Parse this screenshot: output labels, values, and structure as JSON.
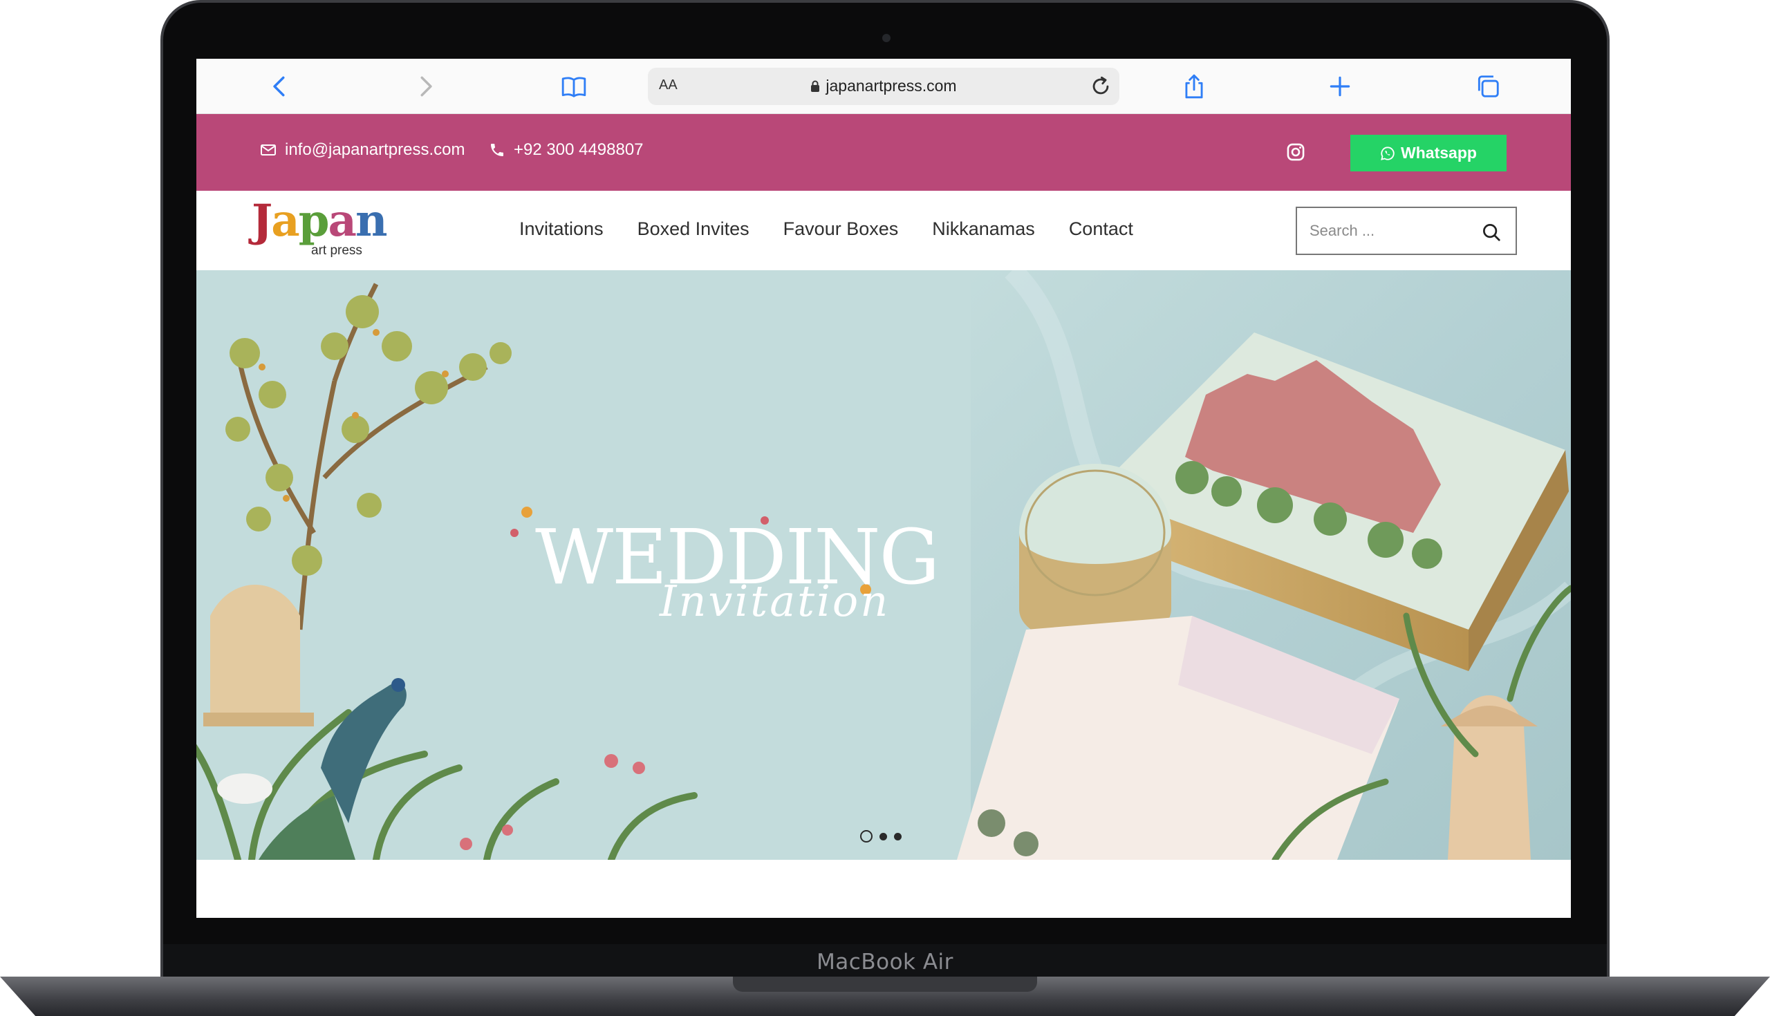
{
  "device": {
    "label": "MacBook Air"
  },
  "browser": {
    "reader_label": "AA",
    "url": "japanartpress.com"
  },
  "topbar": {
    "email": "info@japanartpress.com",
    "phone": "+92 300 4498807",
    "whatsapp_label": "Whatsapp"
  },
  "logo": {
    "name": "Japan",
    "tagline": "art press"
  },
  "nav": {
    "items": [
      {
        "label": "Invitations"
      },
      {
        "label": "Boxed Invites"
      },
      {
        "label": "Favour Boxes"
      },
      {
        "label": "Nikkanamas"
      },
      {
        "label": "Contact"
      }
    ]
  },
  "search": {
    "placeholder": "Search ..."
  },
  "hero": {
    "title": "WEDDING",
    "subtitle": "Invitation",
    "slide_count": 3,
    "active_slide": 1
  },
  "colors": {
    "topbar": "#b94878",
    "whatsapp": "#25d366",
    "hero_bg": "#c3dcdc"
  }
}
